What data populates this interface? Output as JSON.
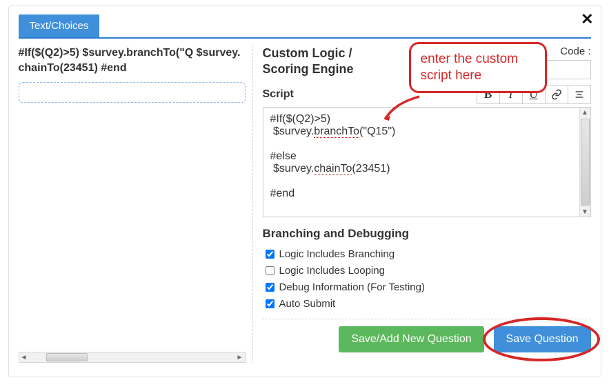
{
  "tab": {
    "label": "Text/Choices"
  },
  "left": {
    "script_text": "#If($(Q2)>5) $survey.branchTo(\"Q $survey.chainTo(23451) #end"
  },
  "header": {
    "title_line1": "Custom Logic /",
    "title_line2": "Scoring Engine",
    "code_label": "Code :",
    "code_value": ""
  },
  "callout": {
    "text": "enter the custom script here"
  },
  "script_section": {
    "label": "Script",
    "toolbar": {
      "bold": "B",
      "italic": "I",
      "underline": "U",
      "link": "🔗",
      "align": "≣"
    },
    "content_lines": [
      "#If($(Q2)>5)",
      " $survey.branchTo(\"Q15\")",
      "",
      "#else",
      " $survey.chainTo(23451)",
      "",
      "#end"
    ]
  },
  "branching": {
    "title": "Branching and Debugging",
    "items": [
      {
        "label": "Logic Includes Branching",
        "checked": true
      },
      {
        "label": "Logic Includes Looping",
        "checked": false
      },
      {
        "label": "Debug Information (For Testing)",
        "checked": true
      },
      {
        "label": "Auto Submit",
        "checked": true
      }
    ]
  },
  "actions": {
    "save_add": "Save/Add New Question",
    "save": "Save Question"
  }
}
